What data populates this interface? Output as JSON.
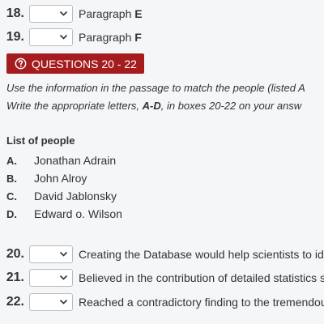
{
  "questions_top": [
    {
      "number": "18.",
      "label": "Paragraph",
      "letter": "E"
    },
    {
      "number": "19.",
      "label": "Paragraph",
      "letter": "F"
    }
  ],
  "banner": {
    "icon": "question-circle-icon",
    "label": "QUESTIONS 20 - 22",
    "color": "#a51c1f"
  },
  "instructions": {
    "line1": "Use the information in the passage to match the people (listed A",
    "line2_pre": "Write the appropriate letters, ",
    "line2_bold": "A-D",
    "line2_post": ", in boxes 20-22 on your answ"
  },
  "list": {
    "title": "List of people",
    "people": [
      {
        "letter": "A.",
        "name": "Jonathan Adrain"
      },
      {
        "letter": "B.",
        "name": "John Alroy"
      },
      {
        "letter": "C.",
        "name": "David Jablonsky"
      },
      {
        "letter": "D.",
        "name": "Edward o. Wilson"
      }
    ]
  },
  "questions_bottom": [
    {
      "number": "20.",
      "text": "Creating the Database would help scientists to id"
    },
    {
      "number": "21.",
      "text": "Believed in the contribution of detailed statistics s"
    },
    {
      "number": "22.",
      "text": "Reached a contradictory finding to the tremendou"
    }
  ]
}
